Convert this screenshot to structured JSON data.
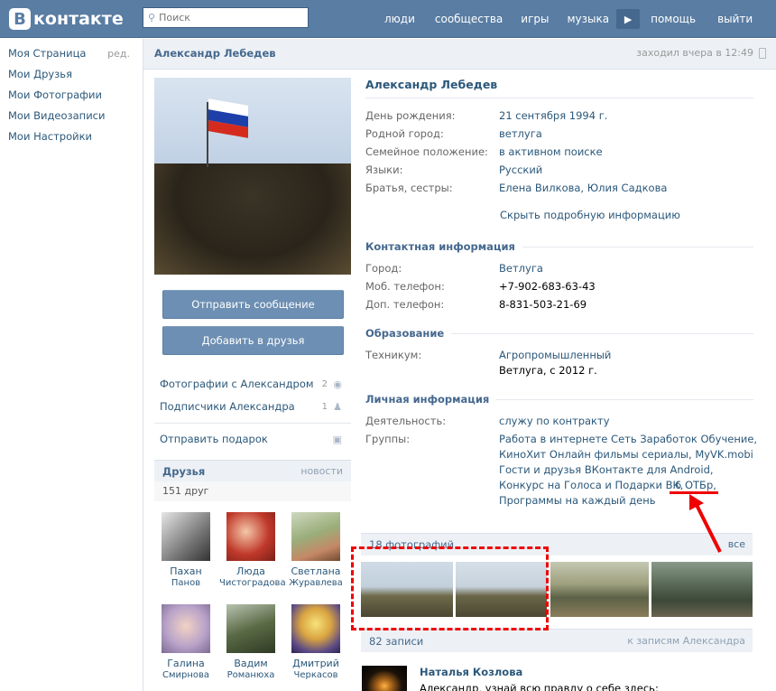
{
  "header": {
    "logo_letter": "В",
    "logo_text": "контакте",
    "search_placeholder": "Поиск",
    "nav": [
      "люди",
      "сообщества",
      "игры",
      "музыка",
      "помощь",
      "выйти"
    ]
  },
  "leftmenu": {
    "items": [
      "Моя Страница",
      "Мои Друзья",
      "Мои Фотографии",
      "Мои Видеозаписи",
      "Мои Настройки"
    ],
    "edit": "ред."
  },
  "profile": {
    "name": "Александр Лебедев",
    "last_seen": "заходил вчера в 12:49"
  },
  "actions": {
    "send_message": "Отправить сообщение",
    "add_friend": "Добавить в друзья",
    "photos_with": "Фотографии с Александром",
    "photos_with_count": "2",
    "subscribers": "Подписчики Александра",
    "subscribers_count": "1",
    "send_gift": "Отправить подарок"
  },
  "friends": {
    "title": "Друзья",
    "news": "новости",
    "count": "151 друг",
    "list": [
      {
        "first": "Пахан",
        "last": "Панов"
      },
      {
        "first": "Люда",
        "last": "Чистоградова"
      },
      {
        "first": "Светлана",
        "last": "Журавлева"
      },
      {
        "first": "Галина",
        "last": "Смирнова"
      },
      {
        "first": "Вадим",
        "last": "Романюха"
      },
      {
        "first": "Дмитрий",
        "last": "Черкасов"
      }
    ]
  },
  "info": {
    "basic": [
      {
        "k": "День рождения:",
        "v": "21 сентября 1994 г."
      },
      {
        "k": "Родной город:",
        "v": "ветлуга"
      },
      {
        "k": "Семейное положение:",
        "v": "в активном поиске"
      },
      {
        "k": "Языки:",
        "v": "Русский"
      },
      {
        "k": "Братья, сестры:",
        "v": "Елена Вилкова, Юлия Садкова"
      }
    ],
    "hide_link": "Скрыть подробную информацию",
    "contact_title": "Контактная информация",
    "contact": [
      {
        "k": "Город:",
        "v": "Ветлуга"
      },
      {
        "k": "Моб. телефон:",
        "v": "+7-902-683-63-43"
      },
      {
        "k": "Доп. телефон:",
        "v": "8-831-503-21-69"
      }
    ],
    "edu_title": "Образование",
    "edu_key": "Техникум:",
    "edu_school": "Агропромышленный",
    "edu_detail": "Ветлуга, с 2012 г.",
    "personal_title": "Личная информация",
    "activity_key": "Деятельность:",
    "activity_val": "служу по контракту",
    "groups_key": "Группы:",
    "groups_lines": [
      "Работа в интернете Сеть Заработок Обучение,",
      "КиноХит Онлайн фильмы сериалы, MyVK.mobi",
      "Гости и друзья ВКонтакте для Android,",
      "Конкурс на Голоса и Подарки ВК,",
      "6 ОТБр,",
      "Программы на каждый день"
    ]
  },
  "photos": {
    "title": "18 фотографий",
    "all": "все"
  },
  "wall": {
    "title": "82 записи",
    "to_posts": "к записям Александра",
    "post_author": "Наталья Козлова",
    "post_text": "Александр, узнай всю правду о себе здесь:"
  },
  "colors": {
    "header_bg": "#597da3",
    "link": "#2b587a",
    "section": "#45688e",
    "annotation": "#ee0000"
  }
}
